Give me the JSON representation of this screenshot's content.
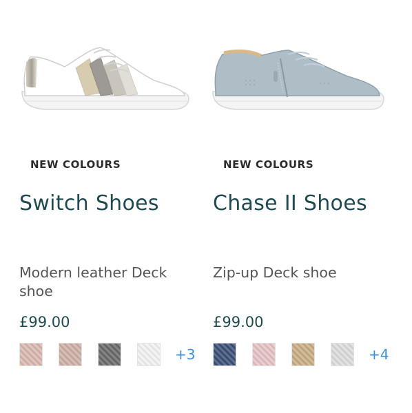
{
  "products": [
    {
      "badge": "NEW COLOURS",
      "title": "Switch Shoes",
      "description": "Modern leather Deck shoe",
      "price": "£99.00",
      "more_colours": "+3",
      "image": "white-leather-sneaker-metallic-stripes",
      "swatch_colors": [
        "#d9b8b0",
        "#cdb0a6",
        "#6a6a6a",
        "#f2f2f2"
      ]
    },
    {
      "badge": "NEW COLOURS",
      "title": "Chase II Shoes",
      "description": "Zip-up Deck shoe",
      "price": "£99.00",
      "more_colours": "+4",
      "image": "light-blue-zip-up-sneaker",
      "swatch_colors": [
        "#3b4f77",
        "#e6c2c4",
        "#c8ad84",
        "#dcdcdc"
      ]
    }
  ]
}
